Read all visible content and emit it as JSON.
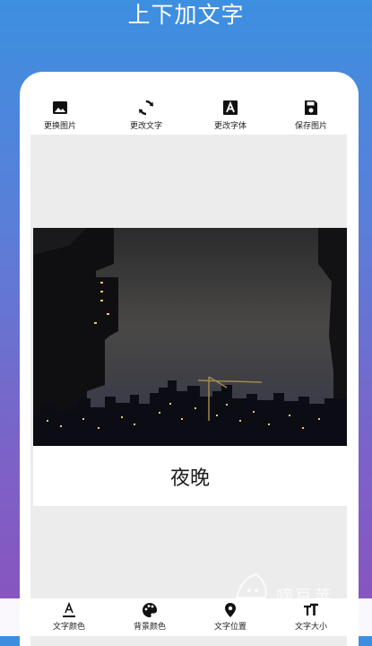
{
  "app": {
    "title": "上下加文字"
  },
  "toolbar": {
    "items": [
      {
        "label": "更换图片",
        "icon": "image-icon"
      },
      {
        "label": "更改文字",
        "icon": "refresh-icon"
      },
      {
        "label": "更改字体",
        "icon": "font-icon"
      },
      {
        "label": "保存图片",
        "icon": "save-icon"
      }
    ]
  },
  "editor": {
    "caption": "夜晚"
  },
  "bottom_bar": {
    "items": [
      {
        "label": "文字颜色",
        "icon": "text-color-icon"
      },
      {
        "label": "背景颜色",
        "icon": "palette-icon"
      },
      {
        "label": "文字位置",
        "icon": "location-pin-icon"
      },
      {
        "label": "文字大小",
        "icon": "text-size-icon"
      }
    ]
  },
  "watermark": {
    "text": "嘀豆荚"
  }
}
